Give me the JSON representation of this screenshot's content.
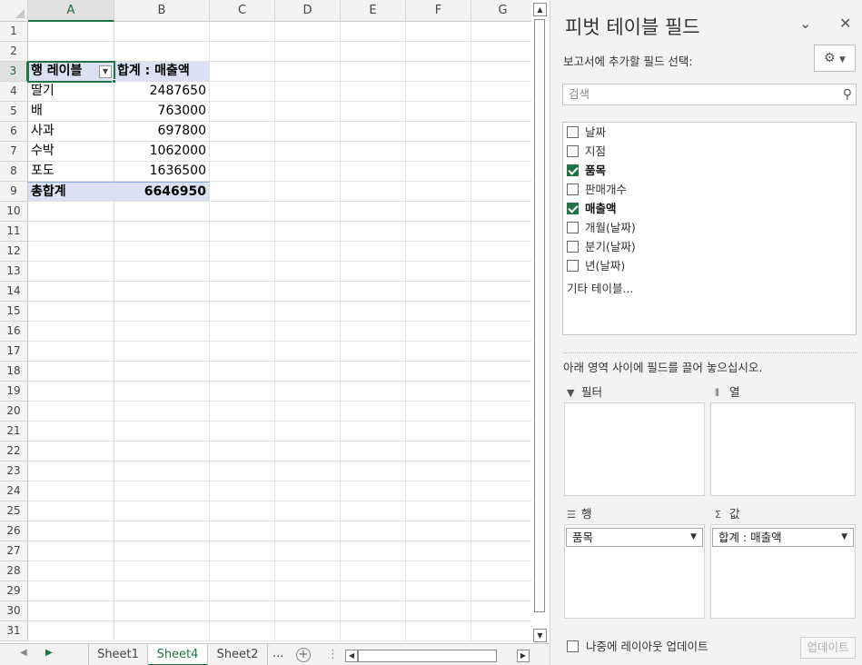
{
  "sheet": {
    "columns": [
      "A",
      "B",
      "C",
      "D",
      "E",
      "F",
      "G"
    ],
    "rows": [
      "1",
      "2",
      "3",
      "4",
      "5",
      "6",
      "7",
      "8",
      "9",
      "10",
      "11",
      "12",
      "13",
      "14",
      "15",
      "16",
      "17",
      "18",
      "19",
      "20",
      "21",
      "22",
      "23",
      "24",
      "25",
      "26",
      "27",
      "28",
      "29",
      "30",
      "31"
    ],
    "pivot": {
      "row_label_header": "행 레이블",
      "value_header": "합계 : 매출액",
      "items": [
        {
          "label": "딸기",
          "value": "2487650"
        },
        {
          "label": "배",
          "value": "763000"
        },
        {
          "label": "사과",
          "value": "697800"
        },
        {
          "label": "수박",
          "value": "1062000"
        },
        {
          "label": "포도",
          "value": "1636500"
        }
      ],
      "total_label": "총합계",
      "total_value": "6646950"
    }
  },
  "tabs": {
    "items": [
      "Sheet1",
      "Sheet4",
      "Sheet2"
    ],
    "active": "Sheet4",
    "more": "..."
  },
  "pane": {
    "title": "피벗 테이블 필드",
    "subtitle": "보고서에 추가할 필드 선택:",
    "search_placeholder": "검색",
    "fields": [
      {
        "label": "날짜",
        "checked": false
      },
      {
        "label": "지점",
        "checked": false
      },
      {
        "label": "품목",
        "checked": true
      },
      {
        "label": "판매개수",
        "checked": false
      },
      {
        "label": "매출액",
        "checked": true
      },
      {
        "label": "개월(날짜)",
        "checked": false
      },
      {
        "label": "분기(날짜)",
        "checked": false
      },
      {
        "label": "년(날짜)",
        "checked": false
      }
    ],
    "more_tables": "기타 테이블...",
    "hint": "아래 영역 사이에 필드를 끌어 놓으십시오.",
    "zones": {
      "filter": "필터",
      "columns": "열",
      "rows": "행",
      "values": "값"
    },
    "row_chip": "품목",
    "value_chip": "합계 : 매출액",
    "defer": "나중에 레이아웃 업데이트",
    "update": "업데이트"
  },
  "colors": {
    "accent": "#217346",
    "pivot_header": "#d9e1f2"
  }
}
